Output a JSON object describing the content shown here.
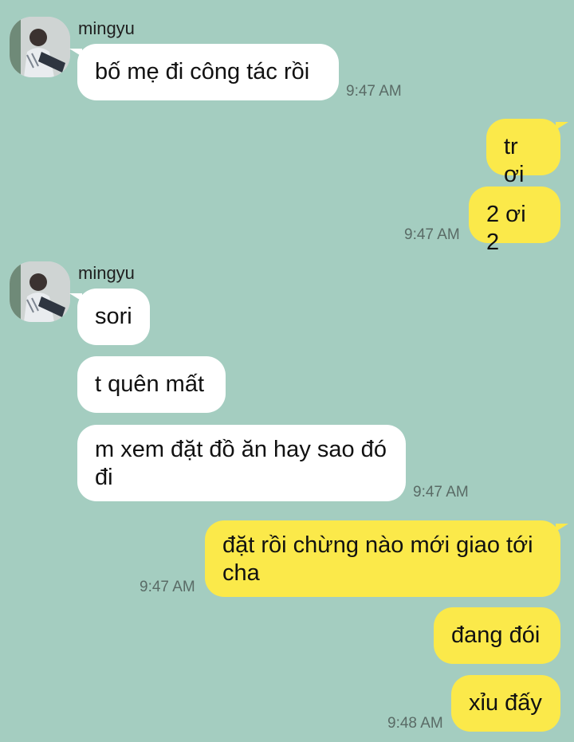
{
  "contact": {
    "name": "mingyu"
  },
  "messages": [
    {
      "side": "in",
      "text": "bố mẹ đi công tác rồi",
      "time": "9:47 AM"
    },
    {
      "side": "out",
      "text": "tr ơi",
      "time": ""
    },
    {
      "side": "out",
      "text": "2 ơi 2",
      "time": "9:47 AM"
    },
    {
      "side": "in",
      "text": "sori",
      "time": ""
    },
    {
      "side": "in",
      "text": "t quên mất",
      "time": ""
    },
    {
      "side": "in",
      "text": "m xem đặt đồ ăn hay sao đó đi",
      "time": "9:47 AM"
    },
    {
      "side": "out",
      "text": "đặt rồi chừng nào mới giao tới cha",
      "time": "9:47 AM"
    },
    {
      "side": "out",
      "text": "đang đói",
      "time": ""
    },
    {
      "side": "out",
      "text": "xỉu đấy",
      "time": "9:48 AM"
    }
  ],
  "colors": {
    "background": "#a4cdc0",
    "incoming_bubble": "#ffffff",
    "outgoing_bubble": "#fbe94a",
    "timestamp": "#5a6b66"
  }
}
